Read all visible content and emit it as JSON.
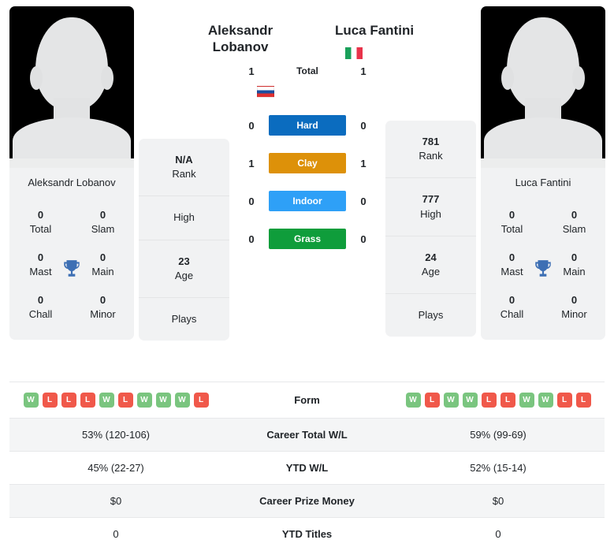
{
  "players": {
    "left": {
      "name": "Aleksandr Lobanov",
      "name_line1": "Aleksandr",
      "name_line2": "Lobanov",
      "country_flag": "russia-flag",
      "avatar": "player-placeholder-avatar",
      "rank": "N/A",
      "rank_label": "Rank",
      "high": "",
      "high_label": "High",
      "age": "23",
      "age_label": "Age",
      "plays": "",
      "plays_label": "Plays",
      "titles": [
        {
          "num": "0",
          "label": "Total"
        },
        {
          "num": "0",
          "label": "Slam"
        },
        {
          "num": "0",
          "label": "Mast"
        },
        {
          "num": "0",
          "label": "Main"
        },
        {
          "num": "0",
          "label": "Chall"
        },
        {
          "num": "0",
          "label": "Minor"
        }
      ],
      "form": [
        "W",
        "L",
        "L",
        "L",
        "W",
        "L",
        "W",
        "W",
        "W",
        "L"
      ],
      "career_total_wl": "53% (120-106)",
      "ytd_wl": "45% (22-27)",
      "career_prize_money": "$0",
      "ytd_titles": "0"
    },
    "right": {
      "name": "Luca Fantini",
      "name_line1": "Luca Fantini",
      "name_line2": "",
      "country_flag": "italy-flag",
      "avatar": "player-placeholder-avatar",
      "rank": "781",
      "rank_label": "Rank",
      "high": "777",
      "high_label": "High",
      "age": "24",
      "age_label": "Age",
      "plays": "",
      "plays_label": "Plays",
      "titles": [
        {
          "num": "0",
          "label": "Total"
        },
        {
          "num": "0",
          "label": "Slam"
        },
        {
          "num": "0",
          "label": "Mast"
        },
        {
          "num": "0",
          "label": "Main"
        },
        {
          "num": "0",
          "label": "Chall"
        },
        {
          "num": "0",
          "label": "Minor"
        }
      ],
      "form": [
        "W",
        "L",
        "W",
        "W",
        "L",
        "L",
        "W",
        "W",
        "L",
        "L"
      ],
      "career_total_wl": "59% (99-69)",
      "ytd_wl": "52% (15-14)",
      "career_prize_money": "$0",
      "ytd_titles": "0"
    }
  },
  "head_to_head": {
    "total": {
      "label": "Total",
      "left": "1",
      "right": "1"
    },
    "surfaces": [
      {
        "label": "Hard",
        "left": "0",
        "right": "0",
        "color": "#0b6cbf"
      },
      {
        "label": "Clay",
        "left": "1",
        "right": "1",
        "color": "#dd9109"
      },
      {
        "label": "Indoor",
        "left": "0",
        "right": "0",
        "color": "#2ea0f7"
      },
      {
        "label": "Grass",
        "left": "0",
        "right": "0",
        "color": "#0f9d3b"
      }
    ]
  },
  "table": {
    "rows": [
      {
        "label": "Form",
        "key": "form",
        "type": "form"
      },
      {
        "label": "Career Total W/L",
        "key": "career_total_wl",
        "type": "text"
      },
      {
        "label": "YTD W/L",
        "key": "ytd_wl",
        "type": "text"
      },
      {
        "label": "Career Prize Money",
        "key": "career_prize_money",
        "type": "text"
      },
      {
        "label": "YTD Titles",
        "key": "ytd_titles",
        "type": "text"
      }
    ]
  },
  "theme": {
    "trophy_color": "#3d6fb4",
    "win_badge_color": "#7ac57f",
    "loss_badge_color": "#f0584a",
    "card_bg": "#f1f2f3"
  }
}
